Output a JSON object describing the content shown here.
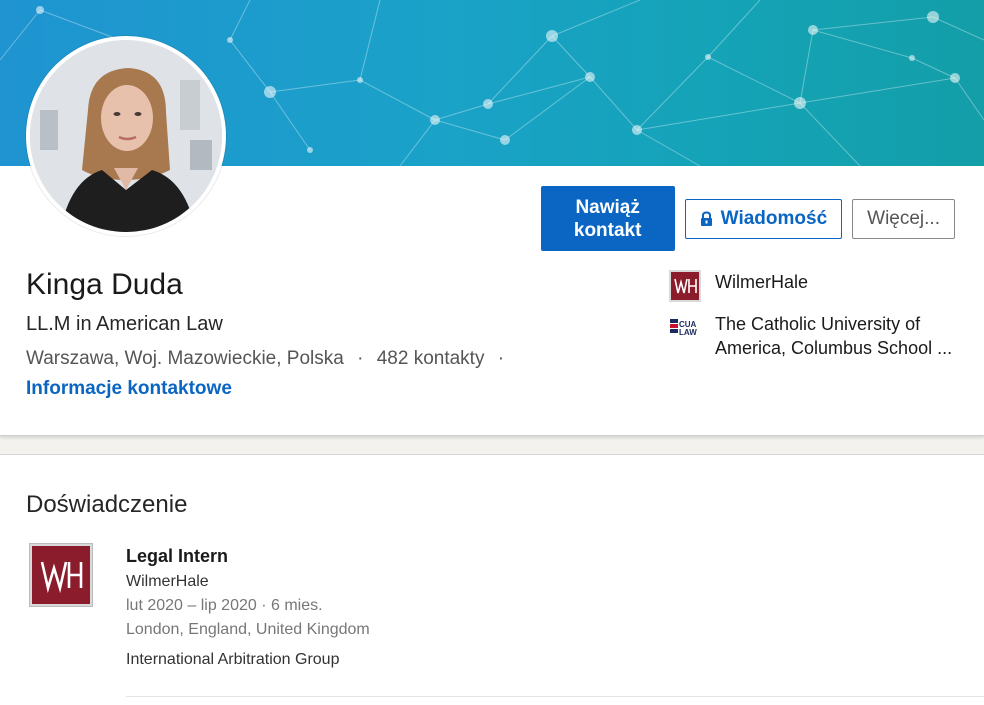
{
  "profile": {
    "name": "Kinga Duda",
    "headline": "LL.M in American Law",
    "location": "Warszawa, Woj. Mazowieckie, Polska",
    "connections": "482 kontakty",
    "separator": "·",
    "contact_info_link": "Informacje kontaktowe"
  },
  "actions": {
    "connect_label": "Nawiąż kontakt",
    "message_label": "Wiadomość",
    "more_label": "Więcej..."
  },
  "organizations": [
    {
      "name": "WilmerHale",
      "logo_text": "WH",
      "color": "#8a1c2b"
    },
    {
      "name": "The Catholic University of America, Columbus School ...",
      "logo_text": "CUA LAW",
      "color": "#1b2a5e"
    }
  ],
  "experience": {
    "section_title": "Doświadczenie",
    "items": [
      {
        "title": "Legal Intern",
        "company": "WilmerHale",
        "dates": "lut 2020 – lip 2020 · 6 mies.",
        "location": "London, England, United Kingdom",
        "description": "International Arbitration Group",
        "logo_text": "WH"
      }
    ]
  },
  "colors": {
    "brand_blue": "#0a66c2",
    "banner_start": "#1f94d1",
    "banner_end": "#139ea8",
    "wilmerhale_red": "#8a1c2b"
  }
}
